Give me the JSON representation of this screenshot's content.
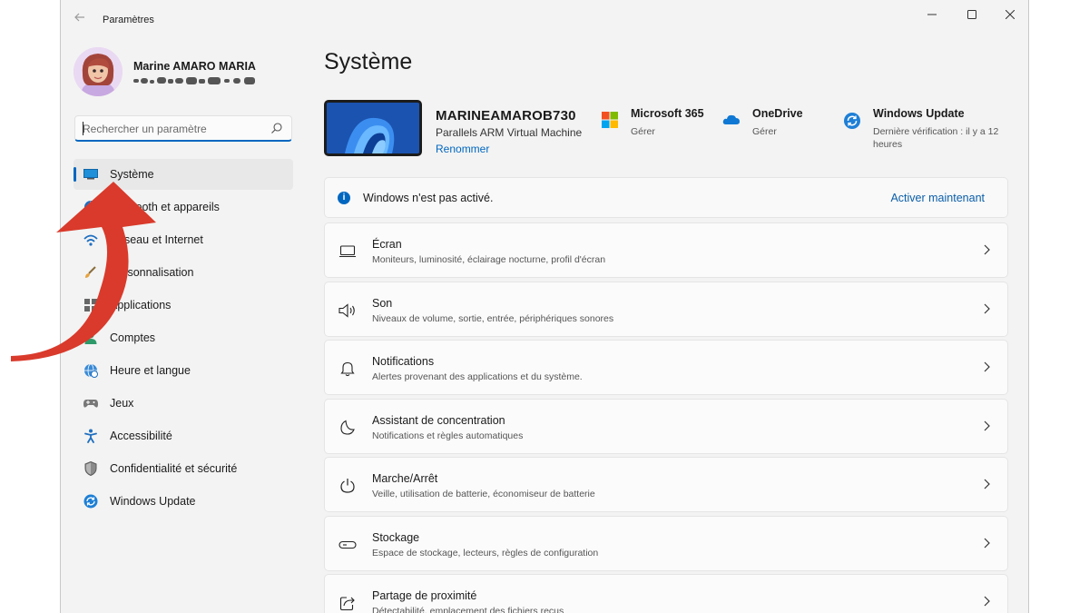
{
  "window": {
    "title": "Paramètres"
  },
  "profile": {
    "name": "Marine AMARO MARIA"
  },
  "search": {
    "placeholder": "Rechercher un paramètre"
  },
  "sidebar": {
    "items": [
      {
        "label": "Système",
        "icon": "monitor-icon",
        "active": true
      },
      {
        "label": "Bluetooth et appareils",
        "icon": "bluetooth-icon"
      },
      {
        "label": "Réseau et Internet",
        "icon": "network-icon"
      },
      {
        "label": "Personnalisation",
        "icon": "brush-icon"
      },
      {
        "label": "Applications",
        "icon": "apps-icon"
      },
      {
        "label": "Comptes",
        "icon": "person-icon"
      },
      {
        "label": "Heure et langue",
        "icon": "globe-clock-icon"
      },
      {
        "label": "Jeux",
        "icon": "gamepad-icon"
      },
      {
        "label": "Accessibilité",
        "icon": "accessibility-icon"
      },
      {
        "label": "Confidentialité et sécurité",
        "icon": "shield-icon"
      },
      {
        "label": "Windows Update",
        "icon": "update-icon"
      }
    ]
  },
  "main": {
    "title": "Système",
    "device": {
      "name": "MARINEAMAROB730",
      "model": "Parallels ARM Virtual Machine",
      "rename": "Renommer"
    },
    "quick_links": [
      {
        "title": "Microsoft 365",
        "sub": "Gérer",
        "icon": "microsoft-logo-icon"
      },
      {
        "title": "OneDrive",
        "sub": "Gérer",
        "icon": "onedrive-cloud-icon"
      },
      {
        "title": "Windows Update",
        "sub": "Dernière vérification : il y a 12 heures",
        "icon": "windows-update-icon"
      }
    ],
    "banner": {
      "text": "Windows n'est pas activé.",
      "link": "Activer maintenant"
    },
    "cards": [
      {
        "title": "Écran",
        "sub": "Moniteurs, luminosité, éclairage nocturne, profil d'écran",
        "icon": "display-icon"
      },
      {
        "title": "Son",
        "sub": "Niveaux de volume, sortie, entrée, périphériques sonores",
        "icon": "speaker-icon"
      },
      {
        "title": "Notifications",
        "sub": "Alertes provenant des applications et du système.",
        "icon": "bell-icon"
      },
      {
        "title": "Assistant de concentration",
        "sub": "Notifications et règles automatiques",
        "icon": "moon-icon"
      },
      {
        "title": "Marche/Arrêt",
        "sub": "Veille, utilisation de batterie, économiseur de batterie",
        "icon": "power-icon"
      },
      {
        "title": "Stockage",
        "sub": "Espace de stockage, lecteurs, règles de configuration",
        "icon": "storage-icon"
      },
      {
        "title": "Partage de proximité",
        "sub": "Détectabilité, emplacement des fichiers reçus",
        "icon": "share-icon"
      }
    ]
  },
  "colors": {
    "accent": "#0067c0",
    "arrow": "#d93a2b"
  }
}
